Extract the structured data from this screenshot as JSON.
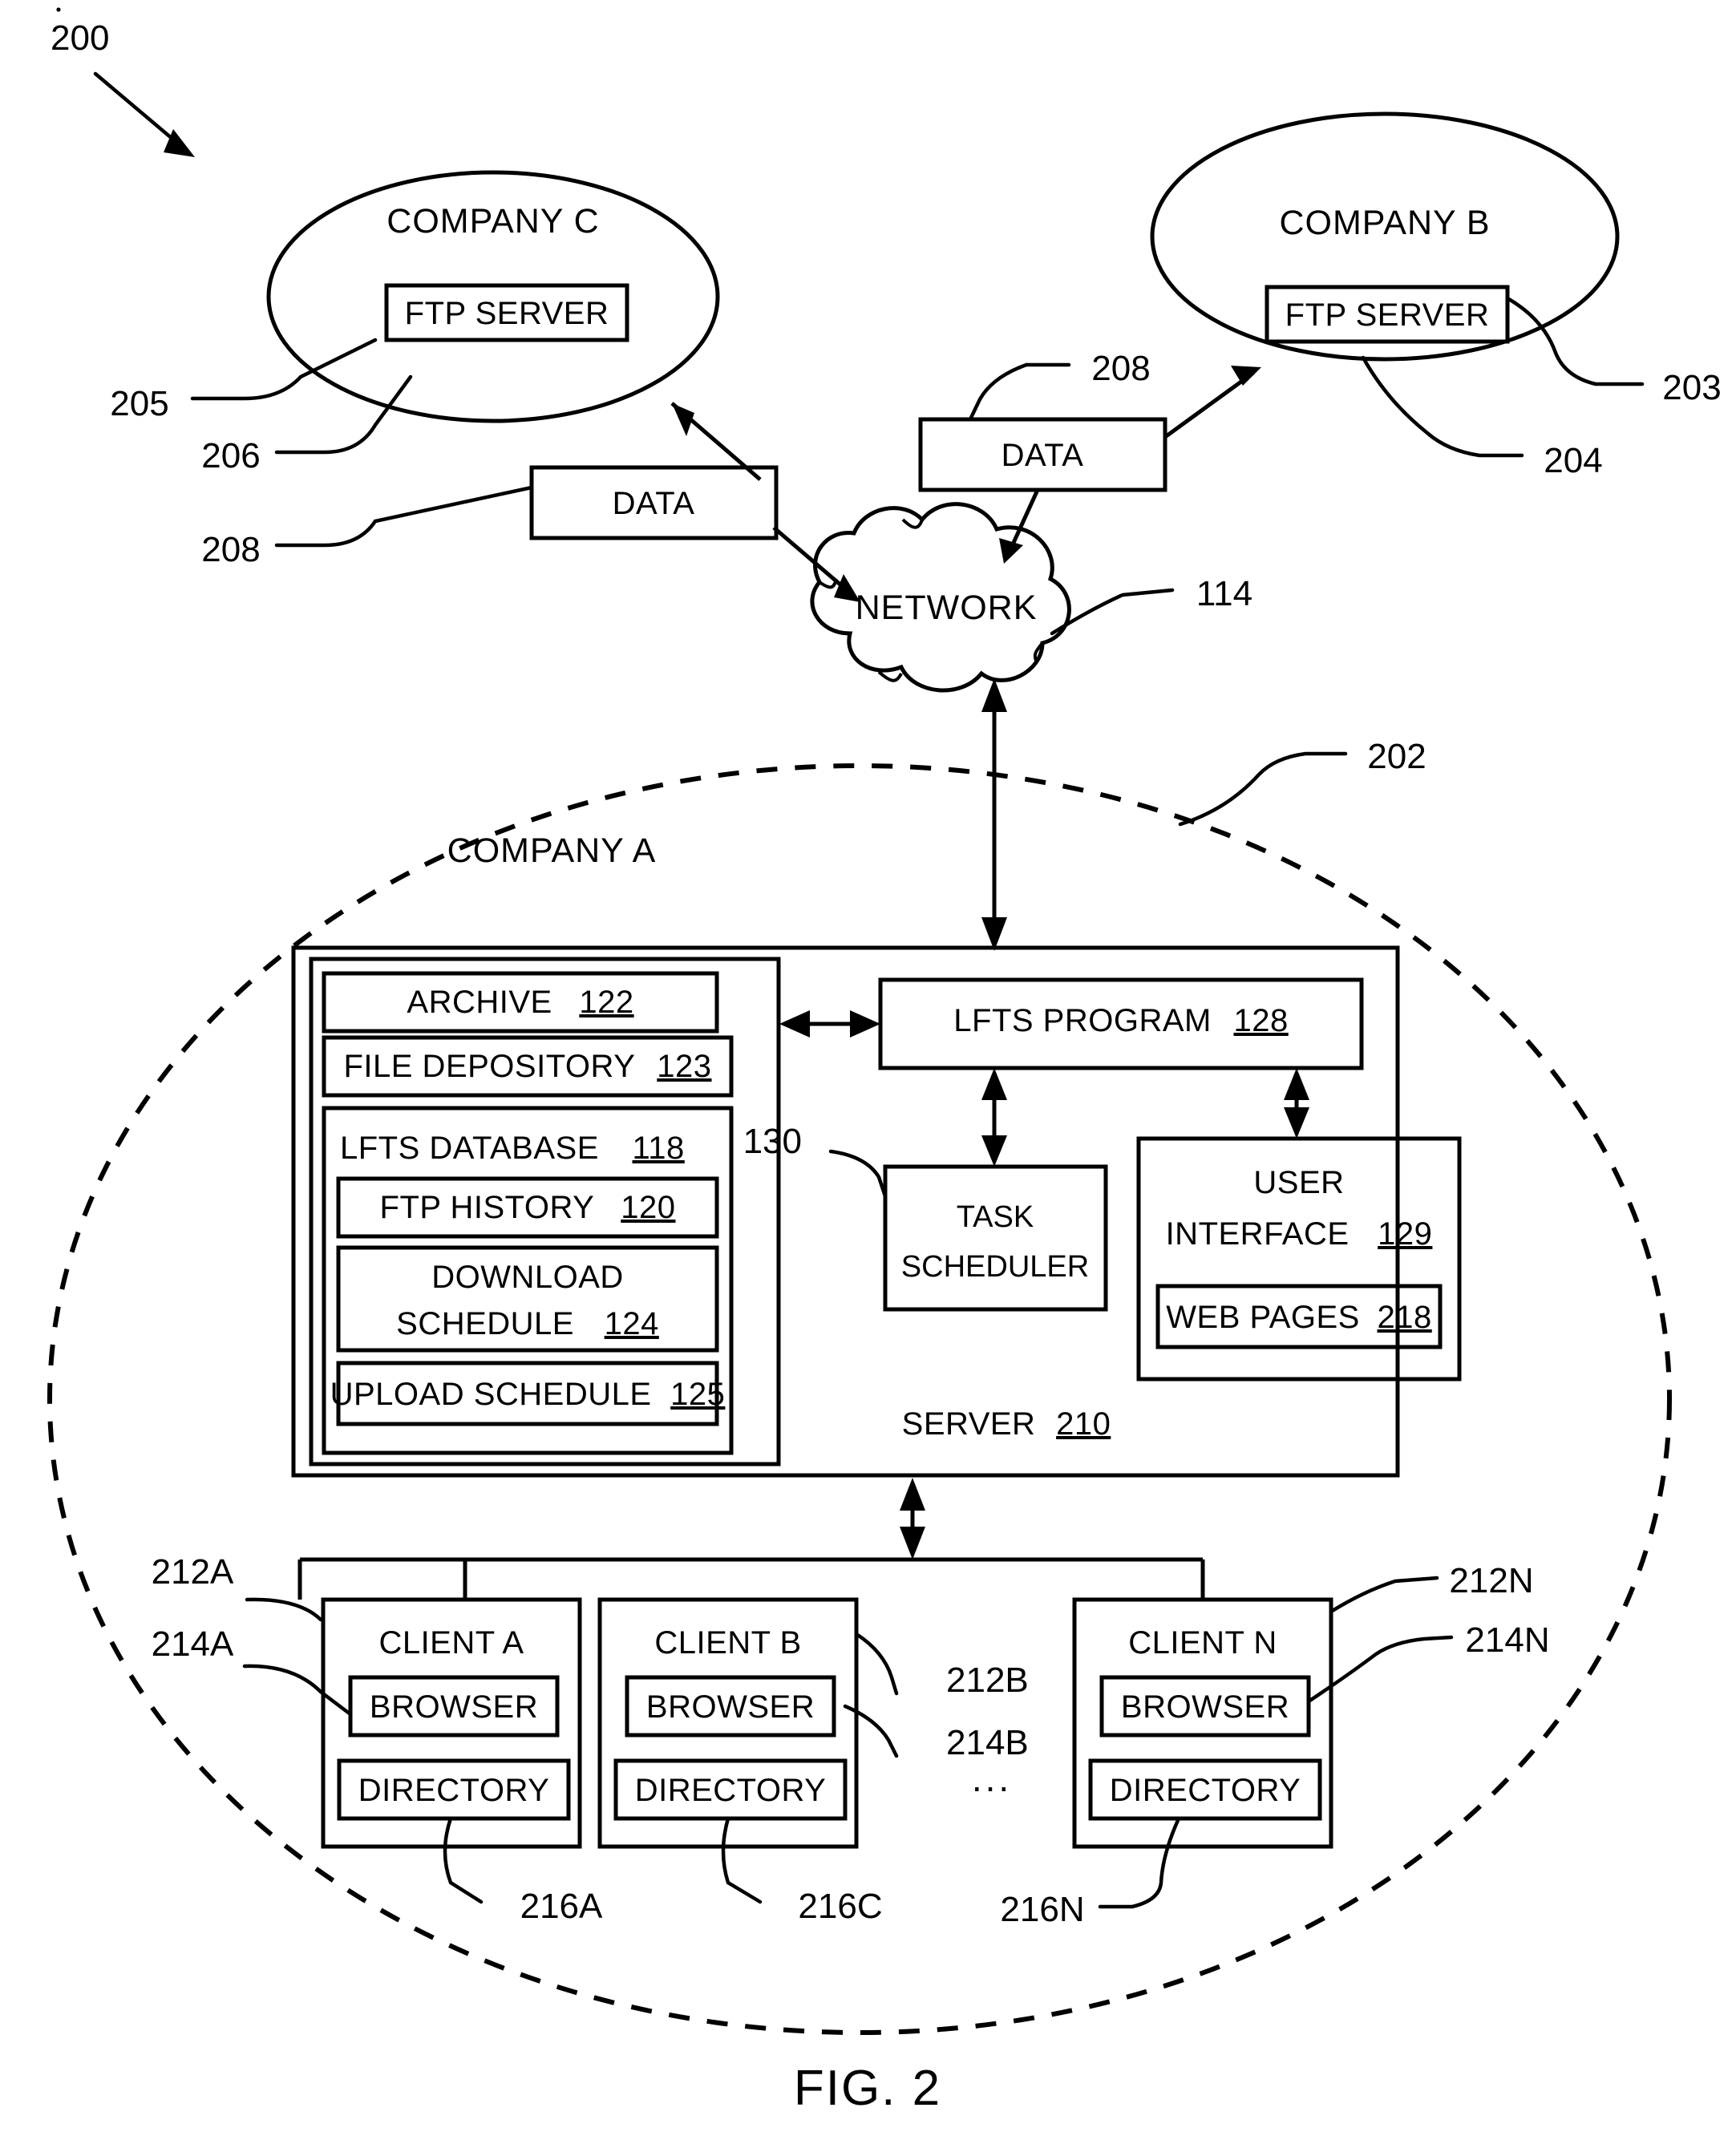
{
  "figure": {
    "caption": "FIG. 2",
    "system_ref": "200"
  },
  "company_c": {
    "label": "COMPANY   C",
    "ellipse_ref": "205",
    "ftp_server": {
      "label": "FTP SERVER",
      "ref": "206"
    },
    "data_box": {
      "label": "DATA",
      "ref": "208"
    }
  },
  "company_b": {
    "label": "COMPANY   B",
    "ellipse_ref": "204",
    "ftp_server": {
      "label": "FTP SERVER",
      "ref": "203"
    },
    "data_box": {
      "label": "DATA",
      "ref": "208"
    }
  },
  "network": {
    "label": "NETWORK",
    "ref": "114"
  },
  "company_a": {
    "label": "COMPANY   A",
    "ref": "202",
    "server": {
      "label": "SERVER",
      "ref": "210",
      "storage_items": [
        {
          "label": "ARCHIVE",
          "ref": "122"
        },
        {
          "label": "FILE DEPOSITORY",
          "ref": "123"
        }
      ],
      "database": {
        "label": "LFTS DATABASE",
        "ref": "118",
        "items": [
          {
            "label": "FTP HISTORY",
            "ref": "120"
          },
          {
            "label": "DOWNLOAD",
            "label2": "SCHEDULE",
            "ref": "124"
          },
          {
            "label": "UPLOAD SCHEDULE",
            "ref": "125"
          }
        ]
      },
      "program": {
        "label": "LFTS PROGRAM",
        "ref": "128"
      },
      "task_scheduler": {
        "label": "TASK",
        "label2": "SCHEDULER",
        "ref": "130"
      },
      "user_interface": {
        "label": "USER",
        "label2": "INTERFACE",
        "ref": "129",
        "web_pages": {
          "label": "WEB PAGES",
          "ref": "218"
        }
      }
    },
    "clients": [
      {
        "label": "CLIENT A",
        "ref": "212A",
        "browser": {
          "label": "BROWSER",
          "ref": "214A"
        },
        "directory": {
          "label": "DIRECTORY",
          "ref": "216A"
        }
      },
      {
        "label": "CLIENT B",
        "ref": "212B",
        "browser": {
          "label": "BROWSER",
          "ref": "214B"
        },
        "directory": {
          "label": "DIRECTORY",
          "ref": "216C"
        }
      },
      {
        "label": "CLIENT N",
        "ref": "212N",
        "browser": {
          "label": "BROWSER",
          "ref": "214N"
        },
        "directory": {
          "label": "DIRECTORY",
          "ref": "216N"
        }
      }
    ],
    "ellipsis": "..."
  }
}
